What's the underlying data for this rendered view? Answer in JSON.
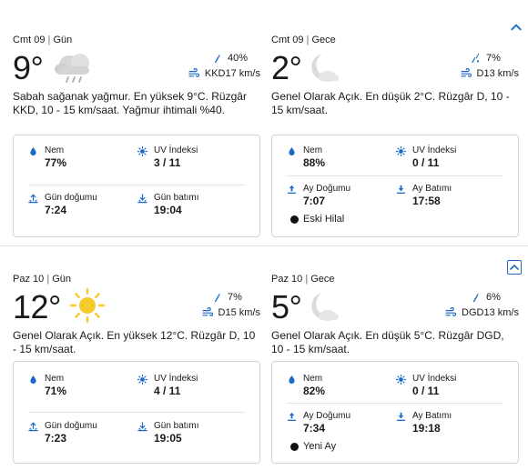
{
  "colors": {
    "accent": "#1b6ac9",
    "text": "#1a1a1a",
    "border": "#d4d4d4"
  },
  "days": [
    {
      "day": {
        "date": "Cmt 09",
        "period": "Gün",
        "temp": "9°",
        "icon": "rain-cloud-icon",
        "precip": "40%",
        "wind": "KKD17 km/s",
        "description": "Sabah sağanak yağmur. En yüksek 9°C. Rüzgâr KKD, 10 - 15 km/saat. Yağmur ihtimali %40.",
        "humidity_label": "Nem",
        "humidity": "77%",
        "uv_label": "UV İndeksi",
        "uv": "3 / 11",
        "rise_label": "Gün doğumu",
        "rise": "7:24",
        "set_label": "Gün batımı",
        "set": "19:04"
      },
      "night": {
        "date": "Cmt 09",
        "period": "Gece",
        "temp": "2°",
        "icon": "moon-cloud-icon",
        "precip": "7%",
        "wind": "D13 km/s",
        "description": "Genel Olarak Açık. En düşük 2°C. Rüzgâr D, 10 - 15 km/saat.",
        "humidity_label": "Nem",
        "humidity": "88%",
        "uv_label": "UV İndeksi",
        "uv": "0 / 11",
        "rise_label": "Ay Doğumu",
        "rise": "7:07",
        "set_label": "Ay Batımı",
        "set": "17:58",
        "moon_phase": "Eski Hilal"
      }
    },
    {
      "day": {
        "date": "Paz 10",
        "period": "Gün",
        "temp": "12°",
        "icon": "sun-icon",
        "precip": "7%",
        "wind": "D15 km/s",
        "description": "Genel Olarak Açık. En yüksek 12°C. Rüzgâr D, 10 - 15 km/saat.",
        "humidity_label": "Nem",
        "humidity": "71%",
        "uv_label": "UV İndeksi",
        "uv": "4 / 11",
        "rise_label": "Gün doğumu",
        "rise": "7:23",
        "set_label": "Gün batımı",
        "set": "19:05"
      },
      "night": {
        "date": "Paz 10",
        "period": "Gece",
        "temp": "5°",
        "icon": "moon-cloud-icon",
        "precip": "6%",
        "wind": "DGD13 km/s",
        "description": "Genel Olarak Açık. En düşük 5°C. Rüzgâr DGD, 10 - 15 km/saat.",
        "humidity_label": "Nem",
        "humidity": "82%",
        "uv_label": "UV İndeksi",
        "uv": "0 / 11",
        "rise_label": "Ay Doğumu",
        "rise": "7:34",
        "set_label": "Ay Batımı",
        "set": "19:18",
        "moon_phase": "Yeni Ay"
      }
    }
  ]
}
